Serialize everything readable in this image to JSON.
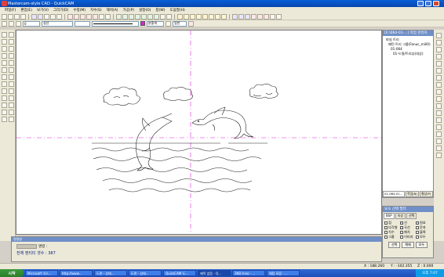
{
  "window": {
    "title": "Mastercam-style CAD - QuickCAM"
  },
  "menu": [
    "파일(F)",
    "편집(E)",
    "보기(V)",
    "그리기(D)",
    "수정(M)",
    "치수(S)",
    "해석(A)",
    "가공(P)",
    "설정(O)",
    "창(W)",
    "도움말(H)"
  ],
  "toolbar2": {
    "layer_value": "0",
    "linetype_value": "실선",
    "color_label": "분홍색",
    "layer_label": "일반"
  },
  "tree_panel": {
    "header": "[E:\\064-01-...] 작업 관리자",
    "items": [
      "파일 트리",
      "패턴 트리 그룹(Fanuc_mill0)",
      "01-064",
      "01-드릴/트리뷰(대상)"
    ],
    "bottom_tabs": [
      "01-064-01...",
      "작업(N)",
      "형상(P)"
    ]
  },
  "prop_panel": {
    "header": "요소 선택 필터",
    "tabs": [
      "BSP",
      "속성",
      "선택"
    ],
    "options": [
      {
        "label": "점",
        "checked": false
      },
      {
        "label": "선",
        "checked": true
      },
      {
        "label": "원호",
        "checked": true
      },
      {
        "label": "다각형",
        "checked": false
      },
      {
        "label": "곡선",
        "checked": true
      },
      {
        "label": "문자",
        "checked": false
      },
      {
        "label": "치수",
        "checked": false
      },
      {
        "label": "해치",
        "checked": false
      },
      {
        "label": "블록",
        "checked": false
      },
      {
        "label": "그룹",
        "checked": false
      },
      {
        "label": "이미지",
        "checked": false
      },
      {
        "label": "모두",
        "checked": false
      }
    ],
    "buttons": [
      "선택",
      "해제",
      "모두"
    ]
  },
  "cmd_panel": {
    "title": "명령창",
    "line1": "명령 :",
    "line2": "전체 엔티티 갯수 : 387"
  },
  "status": {
    "x_coord": "X : 188.260",
    "y_coord": "Y : -102.355",
    "z_coord": "Z : 0.000"
  },
  "taskbar": {
    "start": "시작",
    "tasks": [
      "Microsoft 익스...",
      "http://www...",
      "도면 - 상태...",
      "도면 - 상태...",
      "QuickCAM 도...",
      "제목 없음 - Q...",
      "3ND Inno - ...",
      "채팅 모음 - ..."
    ],
    "clock": "오후 7:07"
  },
  "colors": {
    "title_bar": "#0a5fd8",
    "axis_line": "#e020e0",
    "selected_tab": "#1b47a6"
  }
}
